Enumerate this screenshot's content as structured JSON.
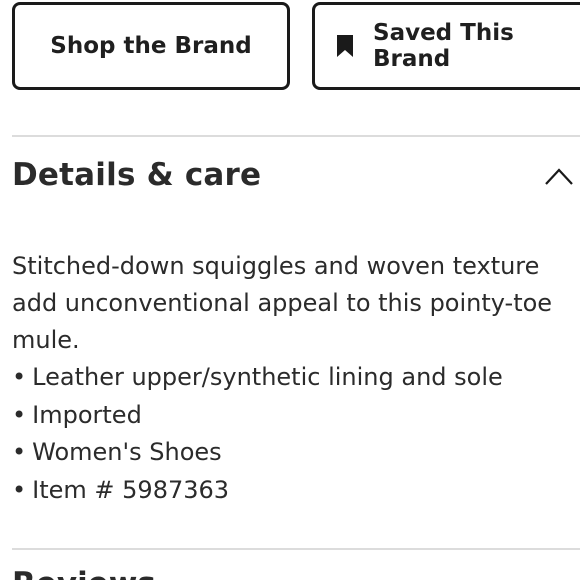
{
  "buttons": {
    "shop_label": "Shop the Brand",
    "saved_label": "Saved This Brand"
  },
  "section": {
    "title": "Details & care",
    "state_icon": "chevron-up-icon"
  },
  "details": {
    "description": "Stitched-down squiggles and woven texture add unconventional appeal to this pointy-toe mule.",
    "bullets": [
      "Leather upper/synthetic lining and sole",
      "Imported",
      "Women's Shoes",
      "Item # 5987363"
    ]
  },
  "next_section": {
    "title": "Reviews"
  },
  "icons": {
    "saved": "bookmark-icon"
  }
}
